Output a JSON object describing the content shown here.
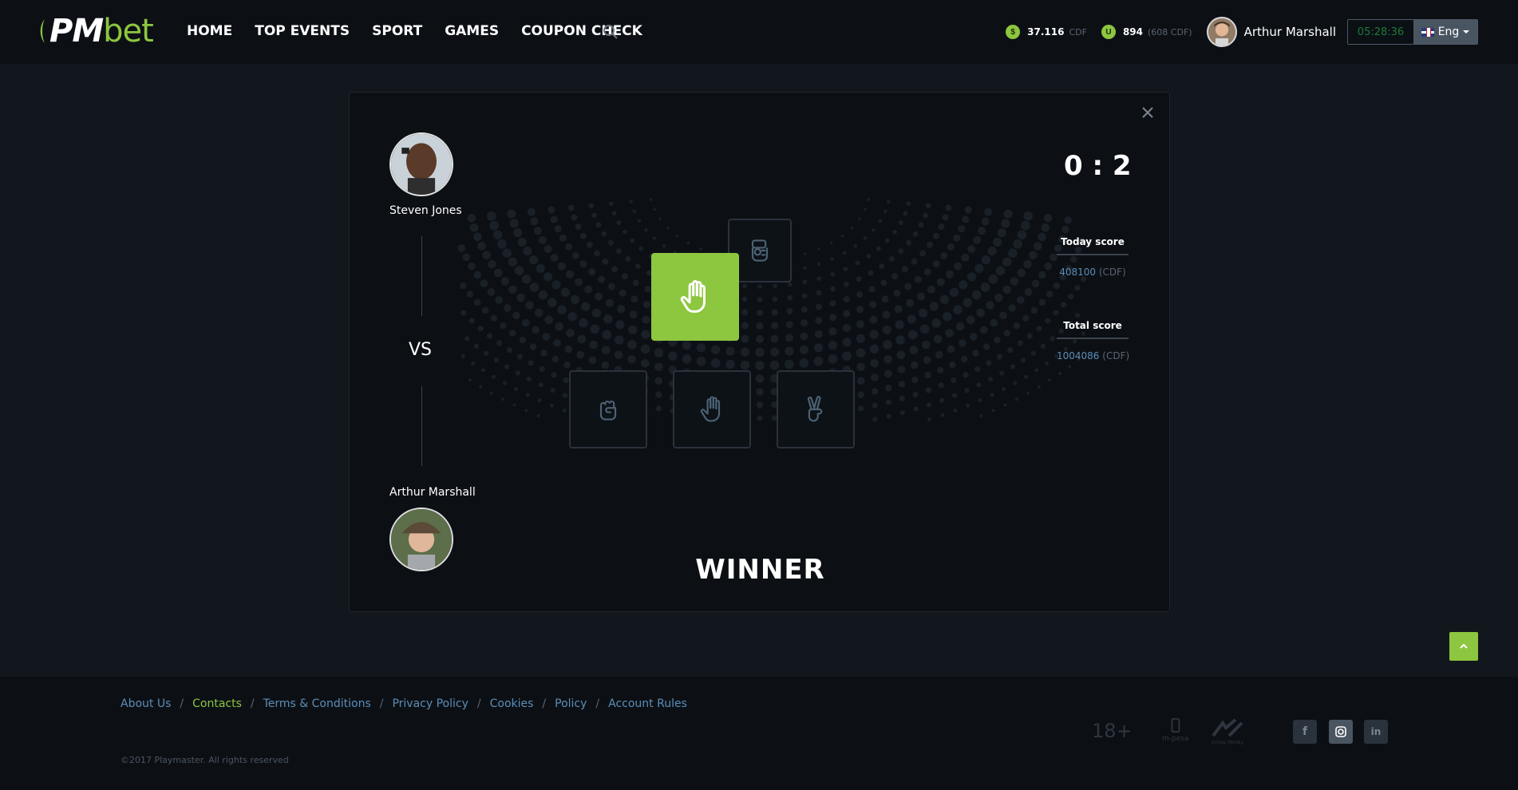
{
  "header": {
    "logo_pm": "PM",
    "logo_bet": "bet",
    "nav": [
      "HOME",
      "TOP EVENTS",
      "SPORT",
      "GAMES",
      "COUPON CHECK"
    ],
    "balance1_value": "37.116",
    "balance1_unit": "CDF",
    "balance2_value": "894",
    "balance2_unit": "(608 CDF)",
    "user_name": "Arthur Marshall",
    "clock": "05:28:36",
    "language": "Eng"
  },
  "game": {
    "player_top": "Steven Jones",
    "player_bottom": "Arthur Marshall",
    "vs_label": "VS",
    "score": "0 : 2",
    "today_score_label": "Today score",
    "today_score_value": "408100",
    "today_score_unit": "(CDF)",
    "total_score_label": "Total score",
    "total_score_value": "1004086",
    "total_score_unit": "(CDF)",
    "result": "WINNER",
    "opponent_choice_icon": "rock-icon",
    "winning_choice_icon": "paper-icon",
    "choices": [
      "rock-icon",
      "paper-icon",
      "scissors-icon"
    ]
  },
  "footer": {
    "links": [
      "About Us",
      "Contacts",
      "Terms & Conditions",
      "Privacy Policy",
      "Cookies",
      "Policy",
      "Account Rules"
    ],
    "active_link": "Contacts",
    "copyright": "©2017 Playmaster. All rights reserved",
    "age_badge": "18+",
    "payment_1": "m-pesa",
    "payment_2": "Group Money",
    "social": [
      "facebook-icon",
      "instagram-icon",
      "linkedin-icon"
    ]
  },
  "colors": {
    "accent": "#8dc63f",
    "background": "#12171d",
    "panel": "#0c1015",
    "link": "#5d8db6"
  }
}
